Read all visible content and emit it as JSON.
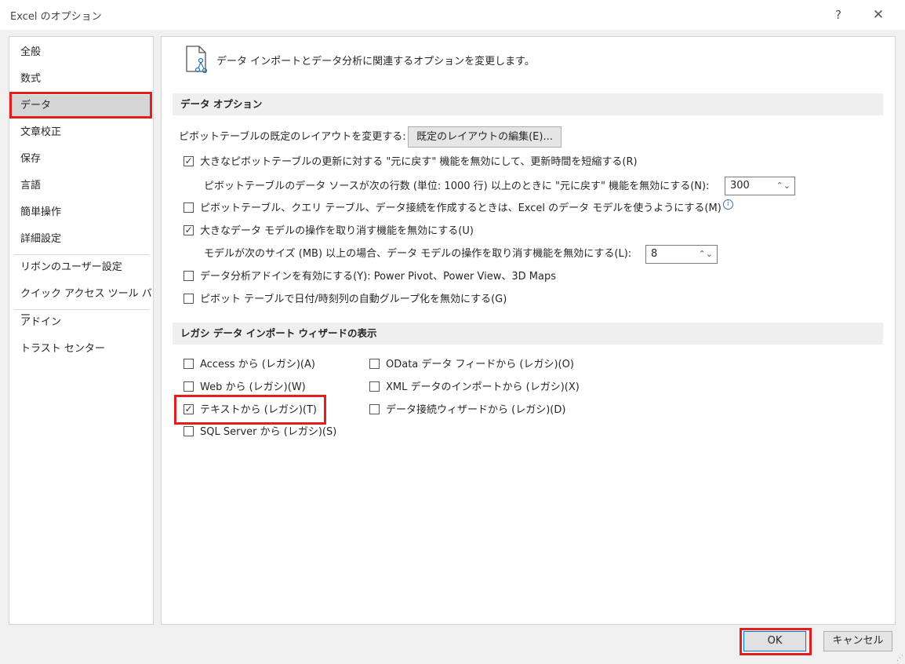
{
  "window": {
    "title": "Excel のオプション",
    "help": "?",
    "close": "✕"
  },
  "nav": {
    "items": [
      "全般",
      "数式",
      "データ",
      "文章校正",
      "保存",
      "言語",
      "簡単操作",
      "詳細設定",
      "リボンのユーザー設定",
      "クイック アクセス ツール バー",
      "アドイン",
      "トラスト センター"
    ],
    "selected": "データ"
  },
  "header": {
    "text": "データ インポートとデータ分析に関連するオプションを変更します。",
    "icon": "document-link-icon"
  },
  "data_options": {
    "title": "データ オプション",
    "pivot_layout_label": "ピボットテーブルの既定のレイアウトを変更する:",
    "pivot_layout_button": "既定のレイアウトの編集(E)...",
    "opt_large_pivot": "大きなピボットテーブルの更新に対する \"元に戻す\" 機能を無効にして、更新時間を短縮する(R)",
    "opt_large_pivot_checked": true,
    "rows_label": "ピボットテーブルのデータ ソースが次の行数 (単位: 1000 行) 以上のときに \"元に戻す\" 機能を無効にする(N):",
    "rows_value": "300",
    "opt_data_model": "ピボットテーブル、クエリ テーブル、データ接続を作成するときは、Excel のデータ モデルを使うようにする(M)",
    "opt_data_model_checked": false,
    "opt_undo_model": "大きなデータ モデルの操作を取り消す機能を無効にする(U)",
    "opt_undo_model_checked": true,
    "size_label": "モデルが次のサイズ (MB) 以上の場合、データ モデルの操作を取り消す機能を無効にする(L):",
    "size_value": "8",
    "opt_addins": "データ分析アドインを有効にする(Y): Power Pivot、Power View、3D Maps",
    "opt_addins_checked": false,
    "opt_date_group": "ピボット テーブルで日付/時刻列の自動グループ化を無効にする(G)",
    "opt_date_group_checked": false
  },
  "legacy": {
    "title": "レガシ データ インポート ウィザードの表示",
    "left": [
      {
        "label": "Access から (レガシ)(A)",
        "checked": false
      },
      {
        "label": "Web から (レガシ)(W)",
        "checked": false
      },
      {
        "label": "テキストから (レガシ)(T)",
        "checked": true
      },
      {
        "label": "SQL Server から (レガシ)(S)",
        "checked": false
      }
    ],
    "right": [
      {
        "label": "OData データ フィードから (レガシ)(O)",
        "checked": false
      },
      {
        "label": "XML データのインポートから (レガシ)(X)",
        "checked": false
      },
      {
        "label": "データ接続ウィザードから (レガシ)(D)",
        "checked": false
      }
    ]
  },
  "footer": {
    "ok": "OK",
    "cancel": "キャンセル"
  },
  "icons": {
    "check": "✓",
    "spin": "⌃⌄",
    "info": "i"
  },
  "colors": {
    "highlight": "#e31e1e",
    "selected_nav": "#d5d5d5"
  }
}
